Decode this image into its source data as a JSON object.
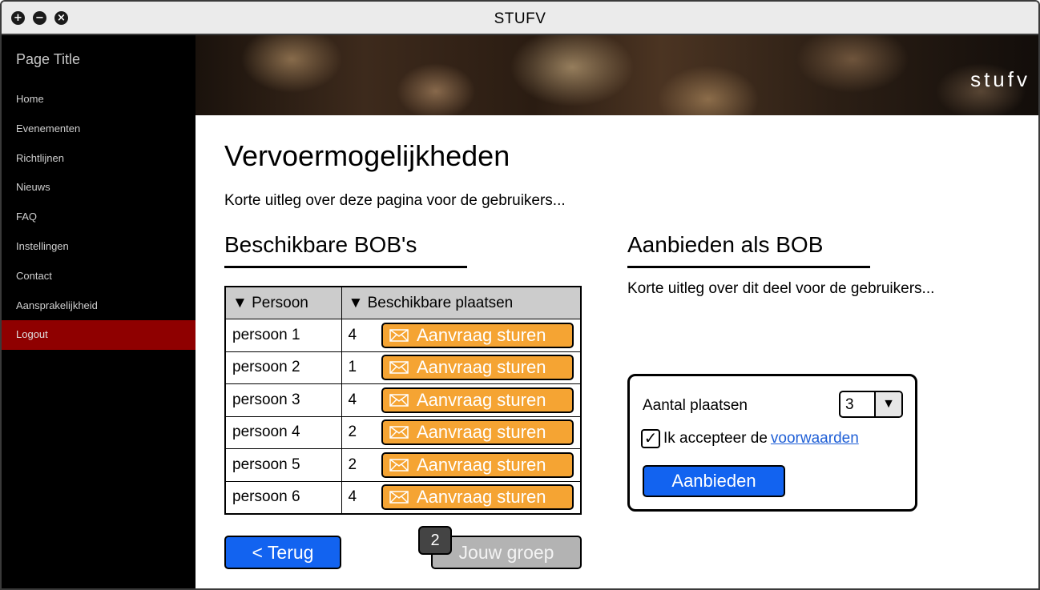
{
  "window": {
    "title": "STUFV",
    "buttons": [
      "add-icon",
      "minimize-icon",
      "close-icon"
    ]
  },
  "sidebar": {
    "page_title": "Page Title",
    "items": [
      {
        "label": "Home"
      },
      {
        "label": "Evenementen"
      },
      {
        "label": "Richtlijnen"
      },
      {
        "label": "Nieuws"
      },
      {
        "label": "FAQ"
      },
      {
        "label": "Instellingen"
      },
      {
        "label": "Contact"
      },
      {
        "label": "Aansprakelijkheid"
      },
      {
        "label": "Logout"
      }
    ]
  },
  "banner": {
    "logo": "stufv"
  },
  "main": {
    "title": "Vervoermogelijkheden",
    "intro": "Korte uitleg over deze pagina voor de gebruikers...",
    "left": {
      "heading": "Beschikbare BOB's",
      "columns": [
        "▼ Persoon",
        "▼ Beschikbare plaatsen"
      ],
      "rows": [
        {
          "name": "persoon 1",
          "places": "4",
          "action": "Aanvraag sturen"
        },
        {
          "name": "persoon 2",
          "places": "1",
          "action": "Aanvraag sturen"
        },
        {
          "name": "persoon 3",
          "places": "4",
          "action": "Aanvraag sturen"
        },
        {
          "name": "persoon 4",
          "places": "2",
          "action": "Aanvraag sturen"
        },
        {
          "name": "persoon 5",
          "places": "2",
          "action": "Aanvraag sturen"
        },
        {
          "name": "persoon 6",
          "places": "4",
          "action": "Aanvraag sturen"
        }
      ]
    },
    "right": {
      "heading": "Aanbieden als BOB",
      "intro": "Korte uitleg over dit deel voor de gebruikers...",
      "seats_label": "Aantal plaatsen",
      "seats_value": "3",
      "accept_text": "Ik accepteer de",
      "accept_link": "voorwaarden",
      "accept_checked": true,
      "submit_label": "Aanbieden"
    },
    "footer": {
      "back_label": "< Terug",
      "group_label": "Jouw groep",
      "group_badge": "2"
    }
  },
  "colors": {
    "accent_blue": "#1263f0",
    "request_orange": "#f5a433",
    "logout_red": "#8f0000",
    "link_blue": "#1f5fd6"
  }
}
